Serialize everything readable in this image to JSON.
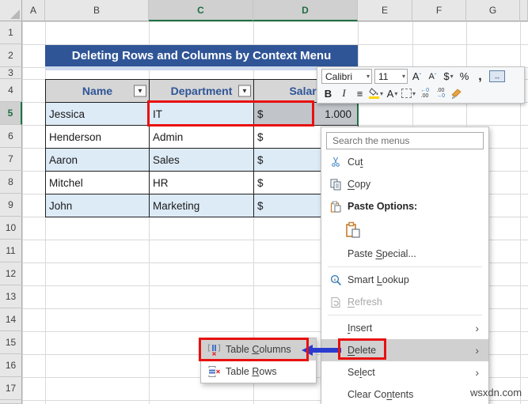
{
  "colors": {
    "banner_blue": "#2F5597",
    "banner_strip": "#CDD9EE",
    "band_blue": "#DDEBF7",
    "selection_green": "#1E7145",
    "annotation_red": "#E81010",
    "arrow_blue": "#2A3BCF",
    "header_grey": "#D6D6D6"
  },
  "grid": {
    "column_headers": [
      "A",
      "B",
      "C",
      "D",
      "E",
      "F",
      "G"
    ],
    "selected_columns": [
      "C",
      "D"
    ],
    "row_headers": [
      "1",
      "2",
      "3",
      "4",
      "5",
      "6",
      "7",
      "8",
      "9",
      "10",
      "11",
      "12",
      "13",
      "14",
      "15",
      "16",
      "17"
    ],
    "selected_row": "5"
  },
  "title_banner": "Deleting Rows and Columns by Context Menu",
  "table": {
    "headers": [
      {
        "label": "Name"
      },
      {
        "label": "Department"
      },
      {
        "label": "Salary"
      }
    ],
    "filter_glyph": "▼",
    "rows": [
      {
        "name": "Jessica",
        "department": "IT",
        "salary_symbol": "$",
        "salary_value": "1.000"
      },
      {
        "name": "Henderson",
        "department": "Admin",
        "salary_symbol": "$"
      },
      {
        "name": "Aaron",
        "department": "Sales",
        "salary_symbol": "$"
      },
      {
        "name": "Mitchel",
        "department": "HR",
        "salary_symbol": "$"
      },
      {
        "name": "John",
        "department": "Marketing",
        "salary_symbol": "$"
      }
    ]
  },
  "mini_toolbar": {
    "font_name": "Calibri",
    "font_size": "11",
    "dropdown_glyph": "▾",
    "grow_font": "A",
    "grow_mark": "ˆ",
    "shrink_font": "A",
    "shrink_mark": "ˇ",
    "accounting": "$",
    "percent": "%",
    "comma": ",",
    "autofit": "↔",
    "bold": "B",
    "italic": "I",
    "borders": "≡",
    "font_color": "A",
    "decrease_decimal": {
      "top": "←0",
      "bottom": ".00"
    },
    "increase_decimal": {
      "top": ".00",
      "bottom": "→0"
    }
  },
  "context_menu": {
    "search_placeholder": "Search the menus",
    "submenu_arrow": "›",
    "items": [
      {
        "label": "Cut",
        "accel": 2
      },
      {
        "label": "Copy",
        "accel": 0
      },
      {
        "label": "Paste Options:",
        "accel": -1
      },
      {
        "label": "",
        "accel": -1
      },
      {
        "label": "Paste Special...",
        "accel": 6
      },
      {
        "label": "Smart Lookup",
        "accel": 6
      },
      {
        "label": "Refresh",
        "accel": 0
      },
      {
        "label": "Insert",
        "accel": 0
      },
      {
        "label": "Delete",
        "accel": 0
      },
      {
        "label": "Select",
        "accel": 2
      },
      {
        "label": "Clear Contents",
        "accel": 8
      }
    ]
  },
  "submenu": {
    "items": [
      {
        "label": "Table Columns",
        "accel": 6
      },
      {
        "label": "Table Rows",
        "accel": 6
      }
    ]
  },
  "selected_cell_value": "1.000",
  "watermark": "wsxdn.com"
}
